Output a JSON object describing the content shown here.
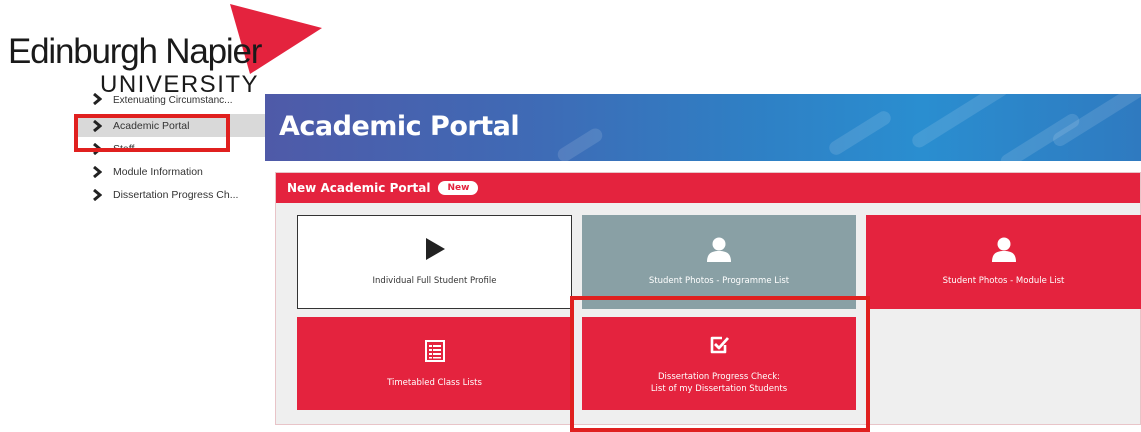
{
  "logo": {
    "name": "Edinburgh Napier",
    "university": "UNIVERSITY",
    "accent": "#e4233e"
  },
  "sidebar": {
    "items": [
      {
        "label": "Extenuating Circumstanc..."
      },
      {
        "label": "Academic Portal",
        "active": true
      },
      {
        "label": "Staff"
      },
      {
        "label": "Module Information"
      },
      {
        "label": "Dissertation Progress Ch..."
      }
    ]
  },
  "banner": {
    "title": "Academic Portal"
  },
  "panel": {
    "title": "New Academic Portal",
    "badge": "New",
    "tiles": [
      {
        "label": "Individual Full Student Profile",
        "icon": "play-icon",
        "style": "white"
      },
      {
        "label": "Student Photos - Programme List",
        "icon": "person-icon",
        "style": "grey"
      },
      {
        "label": "Student Photos - Module List",
        "icon": "person-icon",
        "style": "red"
      },
      {
        "label": "Timetabled Class Lists",
        "icon": "list-icon",
        "style": "red"
      },
      {
        "label": "Dissertation Progress Check:\nList of my Dissertation Students",
        "icon": "checkbox-icon",
        "style": "red"
      }
    ]
  },
  "colors": {
    "brand_red": "#e4233e",
    "highlight_red": "#e0201f",
    "banner_blue": "#2f7fc4",
    "tile_grey": "#89a0a5"
  }
}
